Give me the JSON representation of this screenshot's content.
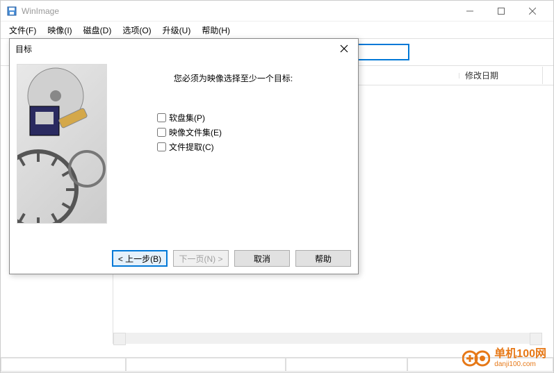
{
  "window": {
    "title": "WinImage"
  },
  "menu": {
    "file": "文件(F)",
    "image": "映像(I)",
    "disk": "磁盘(D)",
    "options": "选项(O)",
    "upgrade": "升级(U)",
    "help": "帮助(H)"
  },
  "columns": {
    "modified": "修改日期"
  },
  "dialog": {
    "title": "目标",
    "heading": "您必须为映像选择至少一个目标:",
    "checkbox1": "软盘集(P)",
    "checkbox2": "映像文件集(E)",
    "checkbox3": "文件提取(C)",
    "btn_back": "< 上一步(B)",
    "btn_next": "下一页(N) >",
    "btn_cancel": "取消",
    "btn_help": "帮助"
  },
  "watermark": {
    "name": "单机100网",
    "url": "danji100.com"
  }
}
